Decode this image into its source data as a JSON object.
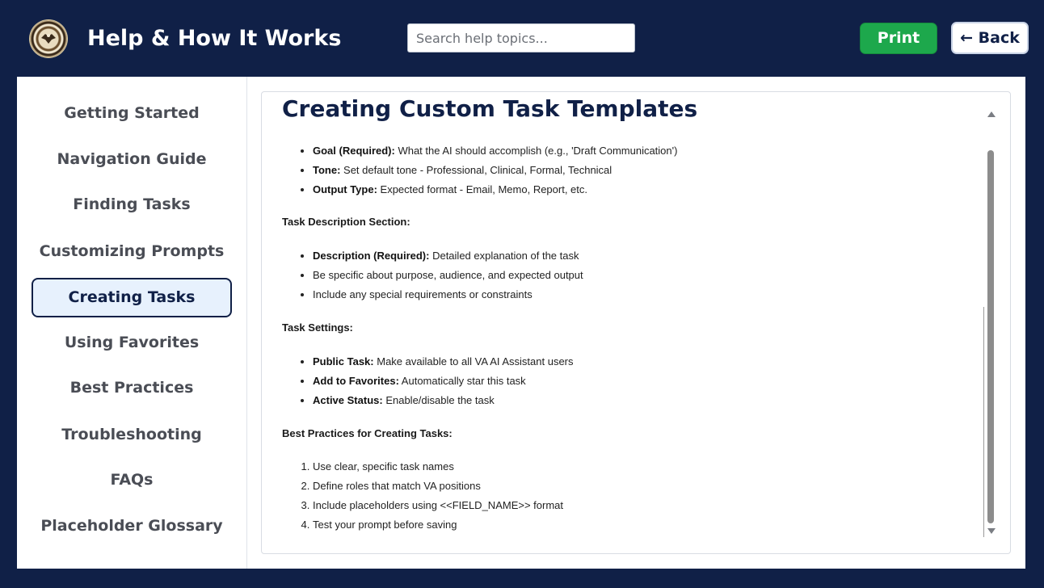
{
  "header": {
    "title": "Help & How It Works",
    "search_placeholder": "Search help topics...",
    "print_label": "Print",
    "back_label": "← Back"
  },
  "sidebar": {
    "items": [
      {
        "label": "Getting Started"
      },
      {
        "label": "Navigation Guide"
      },
      {
        "label": "Finding Tasks"
      },
      {
        "label": "Customizing Prompts"
      },
      {
        "label": "Creating Tasks"
      },
      {
        "label": "Using Favorites"
      },
      {
        "label": "Best Practices"
      },
      {
        "label": "Troubleshooting"
      },
      {
        "label": "FAQs"
      },
      {
        "label": "Placeholder Glossary"
      }
    ],
    "active_index": 4
  },
  "content": {
    "heading": "Creating Custom Task Templates",
    "list1": [
      {
        "bold": "Goal (Required):",
        "text": " What the AI should accomplish (e.g., 'Draft Communication')"
      },
      {
        "bold": "Tone:",
        "text": " Set default tone - Professional, Clinical, Formal, Technical"
      },
      {
        "bold": "Output Type:",
        "text": " Expected format - Email, Memo, Report, etc."
      }
    ],
    "section2_title": "Task Description Section:",
    "list2": [
      {
        "bold": "Description (Required):",
        "text": " Detailed explanation of the task"
      },
      {
        "bold": "",
        "text": "Be specific about purpose, audience, and expected output"
      },
      {
        "bold": "",
        "text": "Include any special requirements or constraints"
      }
    ],
    "section3_title": "Task Settings:",
    "list3": [
      {
        "bold": "Public Task:",
        "text": " Make available to all VA AI Assistant users"
      },
      {
        "bold": "Add to Favorites:",
        "text": " Automatically star this task"
      },
      {
        "bold": "Active Status:",
        "text": " Enable/disable the task"
      }
    ],
    "section4_title": "Best Practices for Creating Tasks:",
    "list4": [
      "Use clear, specific task names",
      "Define roles that match VA positions",
      "Include placeholders using <<FIELD_NAME>> format",
      "Test your prompt before saving"
    ]
  },
  "colors": {
    "navy": "#102047",
    "print_green": "#1da84c",
    "active_bg": "#e7f1fd"
  }
}
